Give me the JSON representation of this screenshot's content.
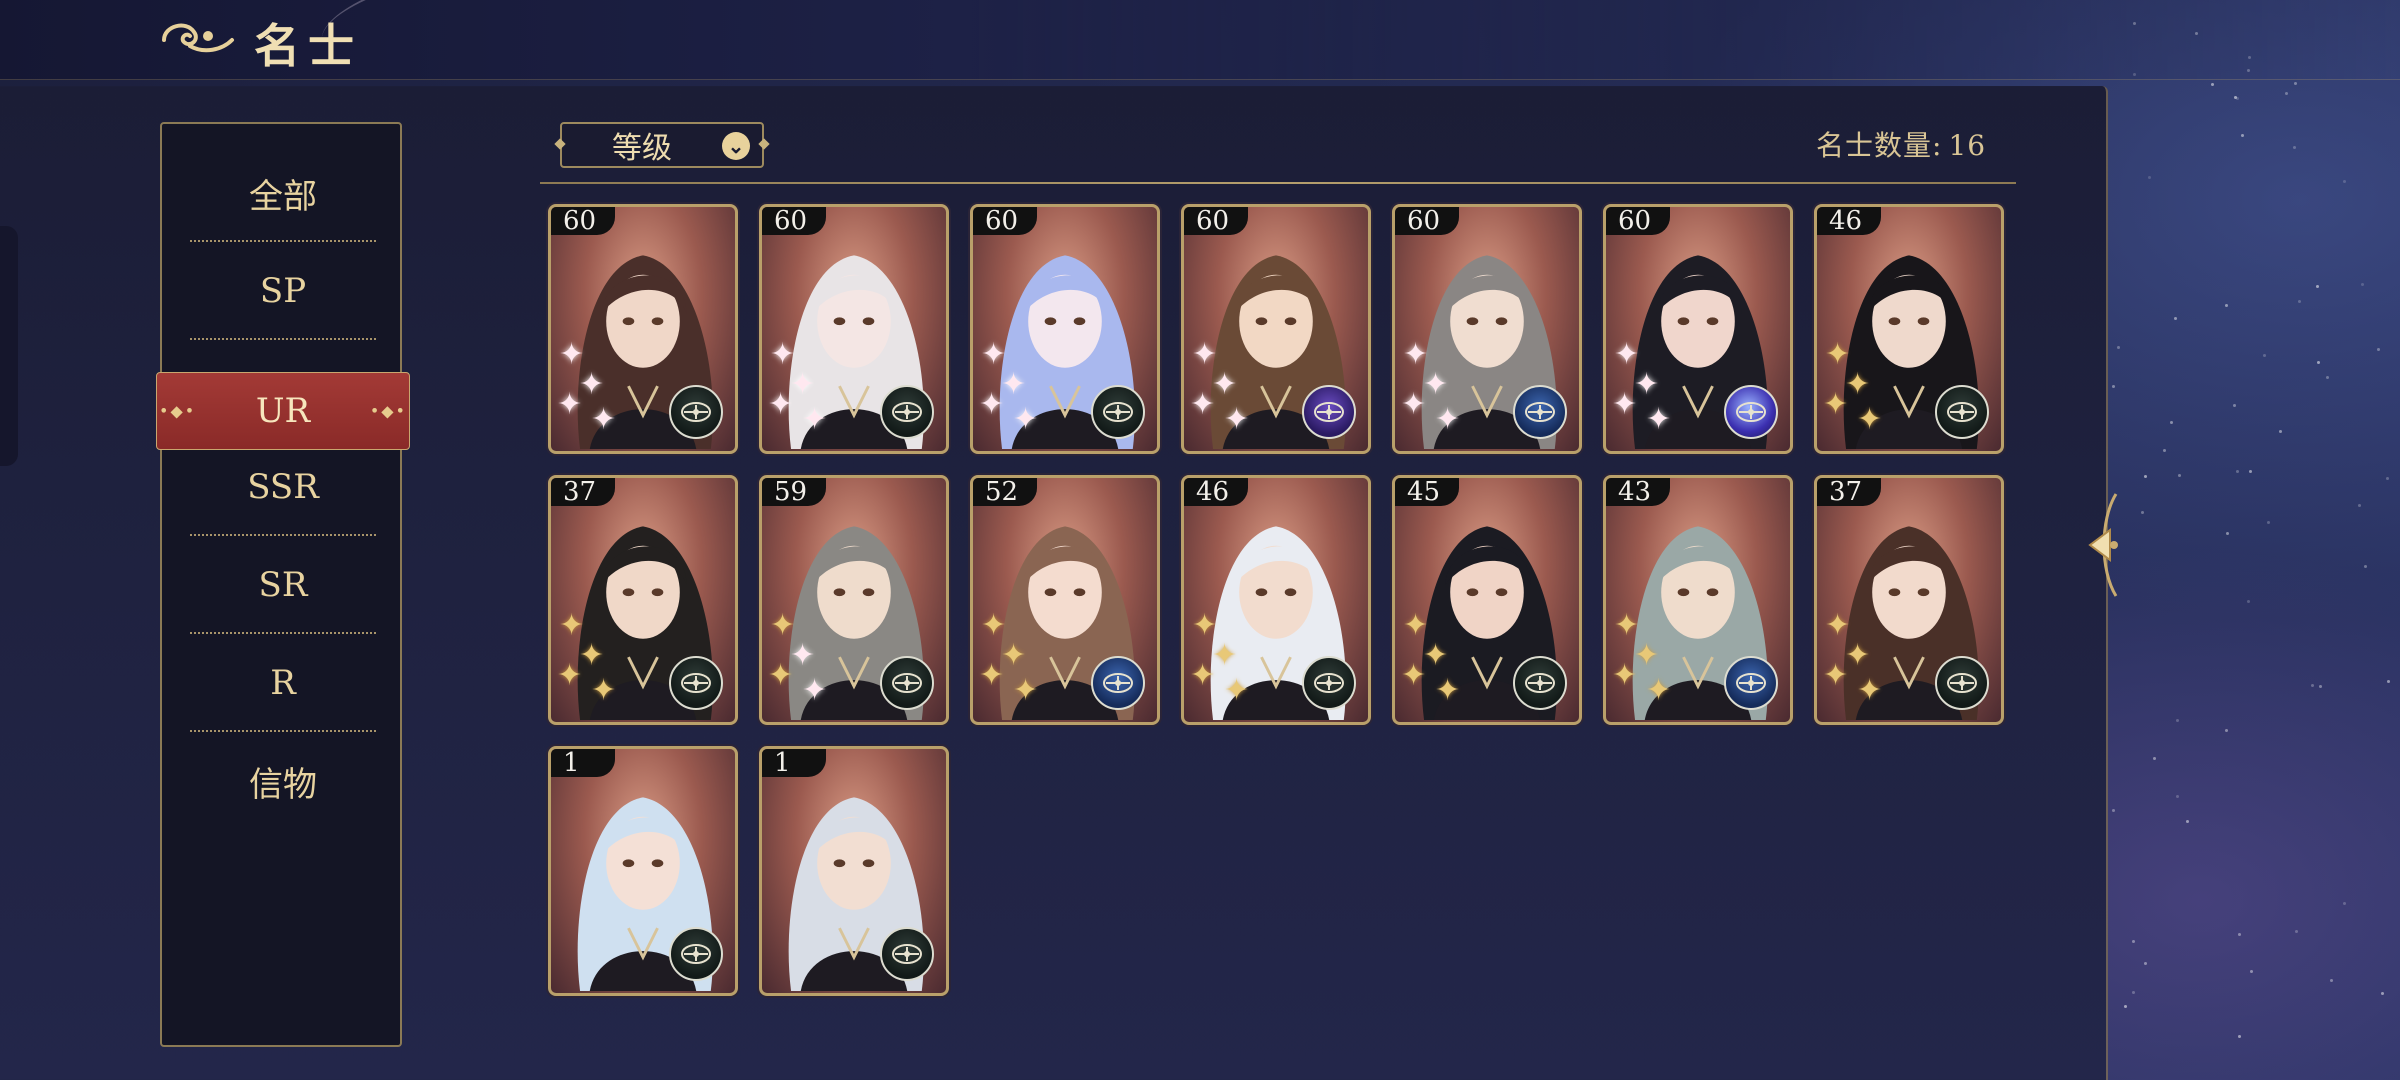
{
  "header": {
    "title": "名士"
  },
  "sidebar": {
    "items": [
      {
        "label": "全部",
        "active": false
      },
      {
        "label": "SP",
        "active": false
      },
      {
        "label": "UR",
        "active": true
      },
      {
        "label": "SSR",
        "active": false
      },
      {
        "label": "SR",
        "active": false
      },
      {
        "label": "R",
        "active": false
      },
      {
        "label": "信物",
        "active": false
      }
    ]
  },
  "toolbar": {
    "sort_label": "等级",
    "count_label": "名士数量:",
    "count_value": "16"
  },
  "cards": [
    {
      "level": "60",
      "badge": "dark",
      "sparkles": "pink"
    },
    {
      "level": "60",
      "badge": "dark",
      "sparkles": "pink"
    },
    {
      "level": "60",
      "badge": "dark",
      "sparkles": "pink"
    },
    {
      "level": "60",
      "badge": "purple",
      "sparkles": "pink"
    },
    {
      "level": "60",
      "badge": "blue",
      "sparkles": "pink"
    },
    {
      "level": "60",
      "badge": "orb",
      "sparkles": "pink"
    },
    {
      "level": "46",
      "badge": "dark",
      "sparkles": "gold"
    },
    {
      "level": "37",
      "badge": "dark",
      "sparkles": "gold"
    },
    {
      "level": "59",
      "badge": "dark",
      "sparkles": "mixed"
    },
    {
      "level": "52",
      "badge": "blue",
      "sparkles": "gold"
    },
    {
      "level": "46",
      "badge": "dark",
      "sparkles": "gold"
    },
    {
      "level": "45",
      "badge": "dark",
      "sparkles": "gold"
    },
    {
      "level": "43",
      "badge": "blue",
      "sparkles": "gold"
    },
    {
      "level": "37",
      "badge": "dark",
      "sparkles": "gold"
    },
    {
      "level": "1",
      "badge": "dark",
      "sparkles": "none"
    },
    {
      "level": "1",
      "badge": "dark",
      "sparkles": "none"
    }
  ],
  "icons": {
    "title_icon": "cloud-swirl-icon",
    "sort_chevron": "chevron-down-icon",
    "card_badge": "compass-icon",
    "edge_tab": "arrow-left-icon"
  },
  "colors": {
    "accent_gold": "#b9a06a",
    "active_red": "#a33a36",
    "background": "#1f2240"
  }
}
